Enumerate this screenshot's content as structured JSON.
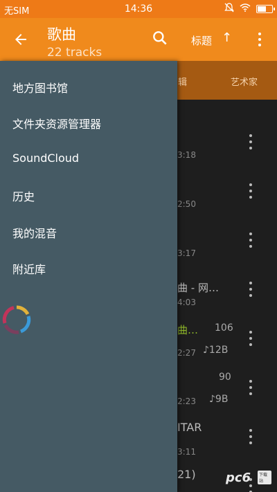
{
  "status_bar": {
    "carrier": "无SIM",
    "time": "14:36",
    "icons": [
      "mute-icon",
      "wifi-icon",
      "battery-icon"
    ]
  },
  "app_bar": {
    "title": "歌曲",
    "subtitle": "22 tracks",
    "sort_label": "标题",
    "sort_arrow": "↑",
    "colors": {
      "status_bar": "#ee7a17",
      "app_bar": "#f08a1c"
    }
  },
  "tabs": {
    "visible": [
      "辑",
      "艺术家"
    ],
    "color": "#a55a12"
  },
  "drawer": {
    "color": "#455a64",
    "items": [
      {
        "label": "地方图书馆"
      },
      {
        "label": "文件夹资源管理器"
      },
      {
        "label": "SoundCloud"
      },
      {
        "label": "历史"
      },
      {
        "label": "我的混音"
      },
      {
        "label": "附近库"
      }
    ]
  },
  "list": {
    "rows": [
      {
        "title": "",
        "duration": "3:18",
        "count": "",
        "size": ""
      },
      {
        "title": "",
        "duration": "2:50",
        "count": "",
        "size": ""
      },
      {
        "title": "",
        "duration": "3:17",
        "count": "",
        "size": ""
      },
      {
        "title": "曲 - 网…",
        "duration": "4:03",
        "count": "",
        "size": ""
      },
      {
        "title": "曲…",
        "duration": "2:27",
        "count": "106",
        "size": "♪12B"
      },
      {
        "title": "",
        "duration": "2:23",
        "count": "90",
        "size": "♪9B"
      },
      {
        "title": "ITAR",
        "duration": "3:11",
        "count": "",
        "size": ""
      },
      {
        "title": "21)",
        "duration": "",
        "count": "",
        "size": ""
      }
    ]
  },
  "watermark": {
    "text": "pc6",
    "badge": "下载站"
  }
}
